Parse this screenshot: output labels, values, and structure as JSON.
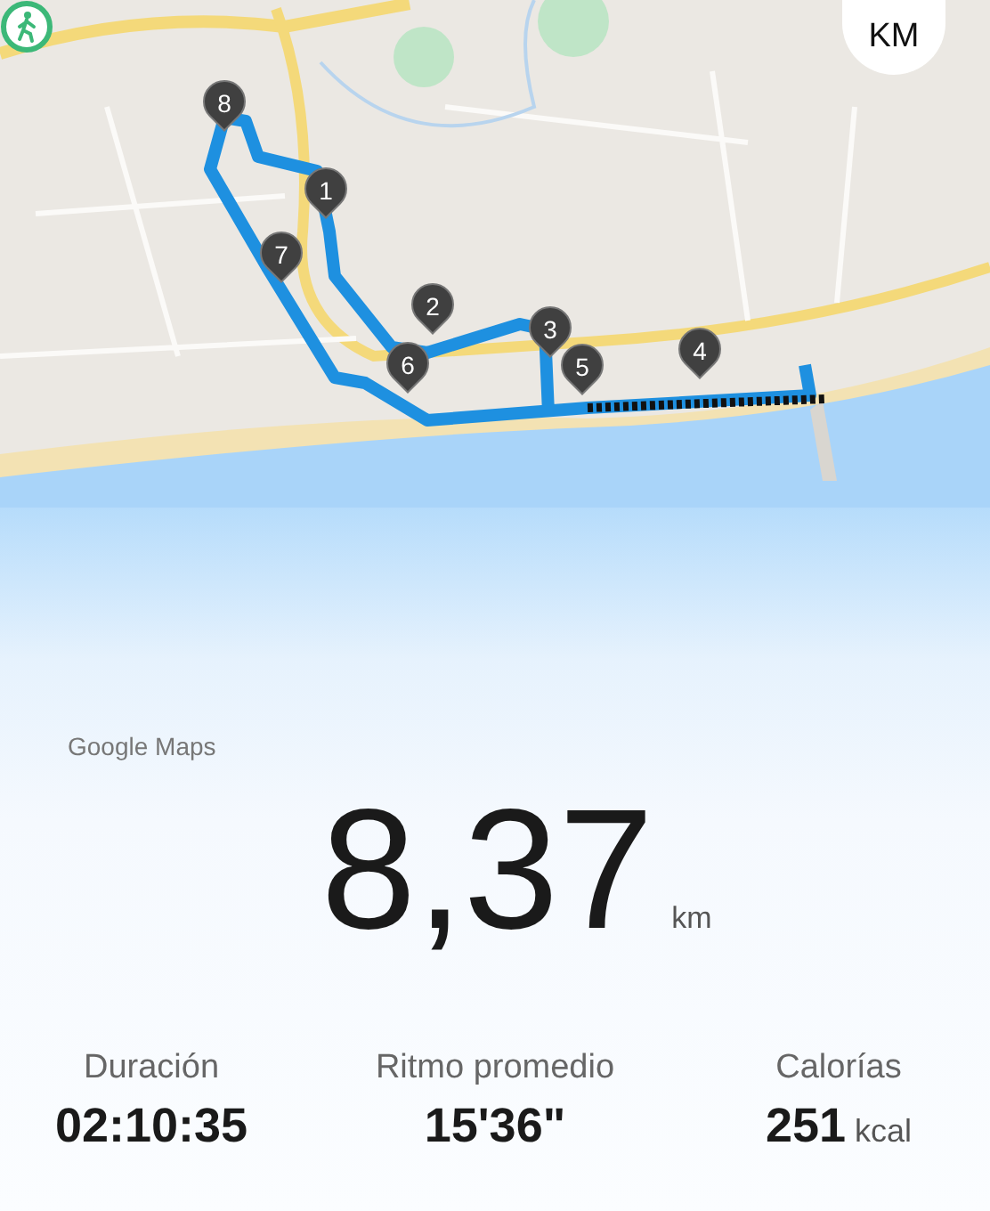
{
  "map": {
    "unit_button": "KM",
    "markers": [
      {
        "label": "1"
      },
      {
        "label": "2"
      },
      {
        "label": "3"
      },
      {
        "label": "4"
      },
      {
        "label": "5"
      },
      {
        "label": "6"
      },
      {
        "label": "7"
      },
      {
        "label": "8"
      }
    ]
  },
  "attribution": "Google Maps",
  "distance": {
    "value": "8,37",
    "unit": "km"
  },
  "stats": [
    {
      "label": "Duración",
      "value": "02:10:35"
    },
    {
      "label": "Ritmo promedio",
      "value": "15'36\""
    },
    {
      "label": "Calorías",
      "value": "251",
      "unit": "kcal"
    }
  ]
}
